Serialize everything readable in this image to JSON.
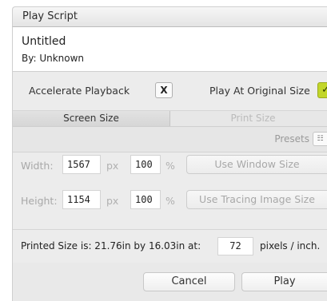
{
  "window": {
    "title": "Play Script"
  },
  "document": {
    "title": "Untitled",
    "author": "By: Unknown"
  },
  "options": {
    "accelerate_label": "Accelerate Playback",
    "accelerate_value": "X",
    "original_size_label": "Play At Original Size",
    "original_size_checked": "✓"
  },
  "tabs": [
    {
      "label": "Screen Size",
      "active": true
    },
    {
      "label": "Print Size",
      "active": false
    }
  ],
  "presets": {
    "label": "Presets",
    "button": "☷"
  },
  "size": {
    "width": {
      "label": "Width:",
      "value": "1567",
      "unit": "px",
      "percent": "100",
      "percent_unit": "%",
      "button": "Use Window Size"
    },
    "height": {
      "label": "Height:",
      "value": "1154",
      "unit": "px",
      "percent": "100",
      "percent_unit": "%",
      "button": "Use Tracing Image Size"
    }
  },
  "printed": {
    "prefix": "Printed Size is: 21.76in by 16.03in at:",
    "dpi": "72",
    "suffix": "pixels / inch."
  },
  "footer": {
    "cancel": "Cancel",
    "play": "Play"
  },
  "colors": {
    "checkbox_accent": "#c2d62a"
  }
}
